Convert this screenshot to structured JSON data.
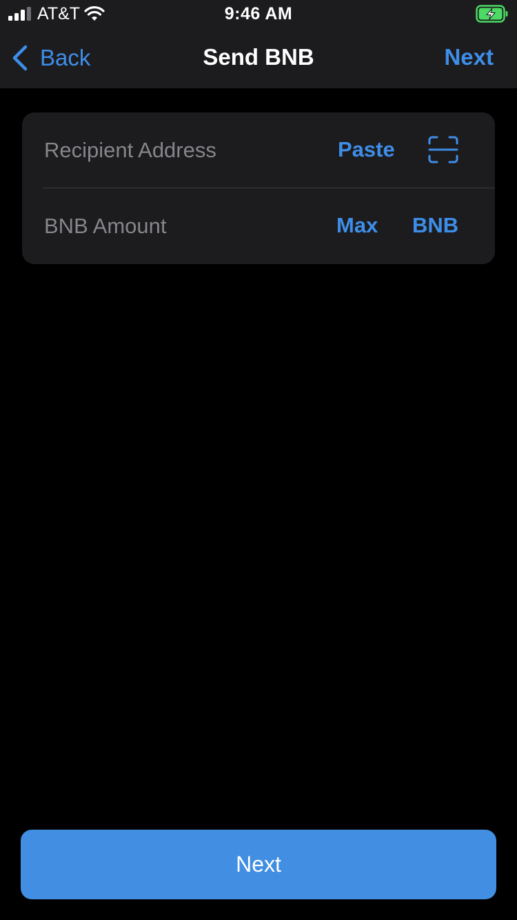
{
  "status_bar": {
    "carrier": "AT&T",
    "time": "9:46 AM",
    "battery_charging": true,
    "battery_color": "#4cd964"
  },
  "nav": {
    "back_label": "Back",
    "title": "Send BNB",
    "next_label": "Next"
  },
  "form": {
    "recipient": {
      "placeholder": "Recipient Address",
      "value": "",
      "paste_label": "Paste",
      "scan_icon": "qr-scan-icon"
    },
    "amount": {
      "placeholder": "BNB Amount",
      "value": "",
      "max_label": "Max",
      "unit_label": "BNB"
    }
  },
  "footer": {
    "next_button_label": "Next"
  },
  "colors": {
    "accent": "#3e8ee9",
    "button_fill": "#418ee3",
    "surface": "#1c1c1e",
    "background": "#000000"
  }
}
